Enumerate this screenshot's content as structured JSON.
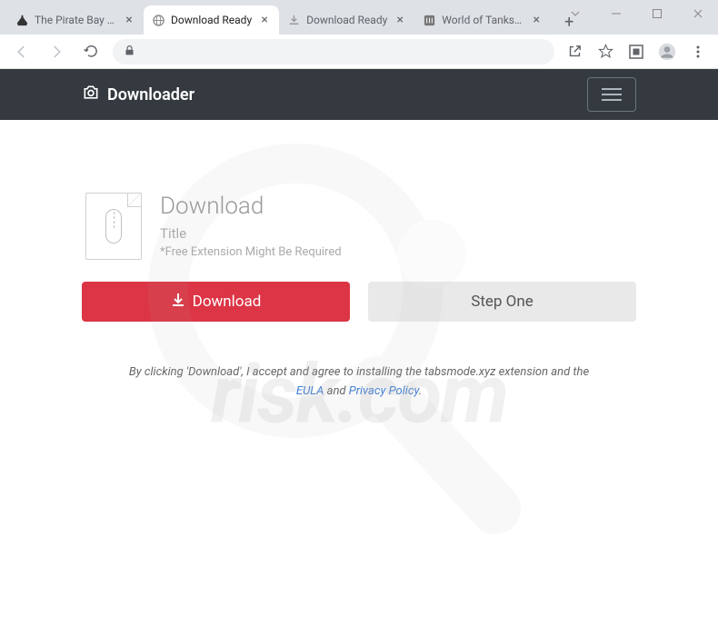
{
  "window": {
    "tabs": [
      {
        "title": "The Pirate Bay - Th",
        "active": false
      },
      {
        "title": "Download Ready",
        "active": true
      },
      {
        "title": "Download Ready",
        "active": false
      },
      {
        "title": "World of Tanks—Fr",
        "active": false
      }
    ]
  },
  "header": {
    "brand": "Downloader"
  },
  "main": {
    "heading": "Download",
    "subtitle": "Title",
    "note": "*Free Extension Might Be Required",
    "primary_button": "Download",
    "secondary_button": "Step One"
  },
  "disclaimer": {
    "prefix": "By clicking 'Download', I accept and agree to installing the tabsmode.xyz extension and the ",
    "eula": "EULA",
    "connector": " and ",
    "privacy": "Privacy Policy",
    "suffix": "."
  }
}
